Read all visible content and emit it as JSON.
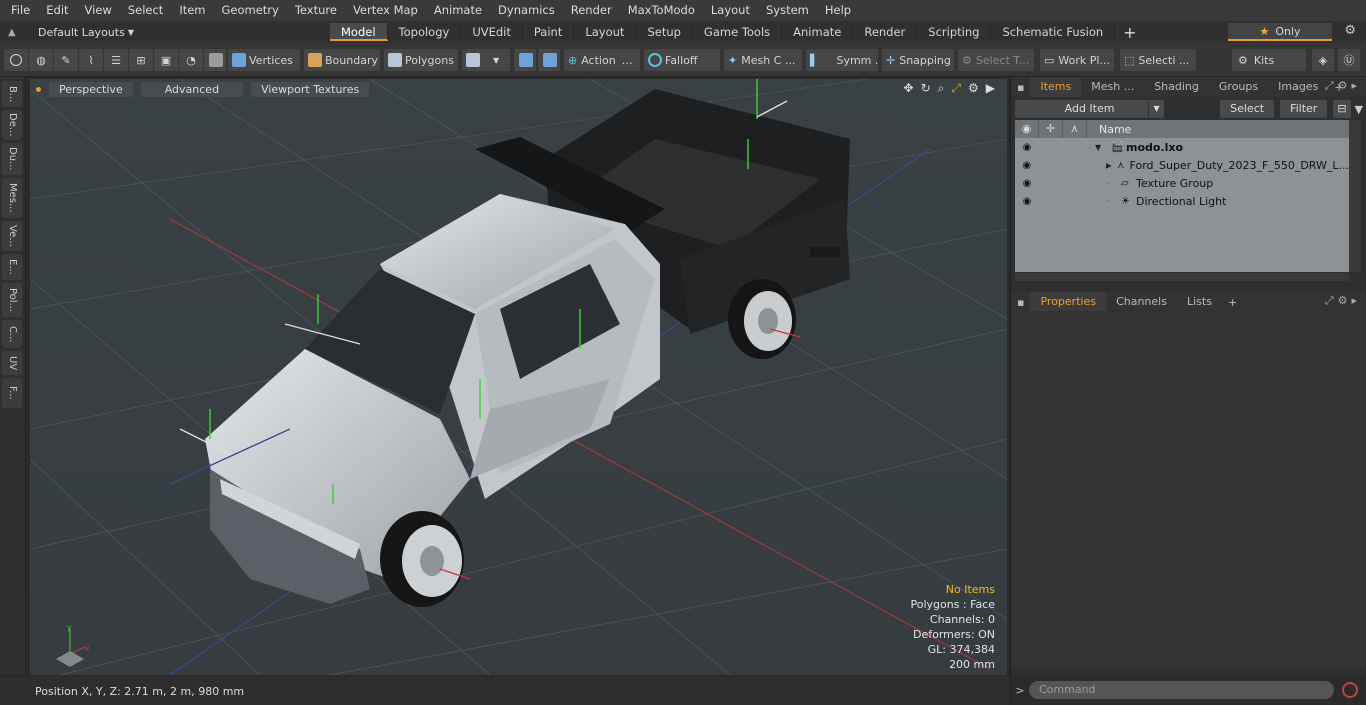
{
  "menubar": {
    "items": [
      "File",
      "Edit",
      "View",
      "Select",
      "Item",
      "Geometry",
      "Texture",
      "Vertex Map",
      "Animate",
      "Dynamics",
      "Render",
      "MaxToModo",
      "Layout",
      "System",
      "Help"
    ]
  },
  "tabbar": {
    "layout_label": "Default Layouts",
    "tabs": [
      "Model",
      "Topology",
      "UVEdit",
      "Paint",
      "Layout",
      "Setup",
      "Game Tools",
      "Animate",
      "Render",
      "Scripting",
      "Schematic Fusion"
    ],
    "active_tab": "Model",
    "only_label": "Only"
  },
  "toolbar": {
    "vertices": "Vertices",
    "boundary": "Boundary",
    "polygons": "Polygons",
    "action": "Action",
    "falloff": "Falloff",
    "mesh": "Mesh C ...",
    "symm": "Symm ...",
    "snapping": "Snapping",
    "select_t": "Select T...",
    "work_pl": "Work Pl...",
    "selecti": "Selecti ...",
    "kits": "Kits"
  },
  "leftstrip": {
    "tabs": [
      "B...",
      "De...",
      "Du...",
      "Mes...",
      "Ve...",
      "E...",
      "Pol...",
      "C...",
      "UV",
      "F..."
    ]
  },
  "viewport": {
    "perspective": "Perspective",
    "advanced": "Advanced",
    "viewport_textures": "Viewport Textures",
    "stats": {
      "no_items": "No Items",
      "polygons": "Polygons : Face",
      "channels": "Channels: 0",
      "deformers": "Deformers: ON",
      "gl": "GL: 374,384",
      "unit": "200 mm"
    }
  },
  "statusbar": {
    "position": "Position X, Y, Z:   2.71 m, 2 m, 980 mm"
  },
  "items_panel": {
    "tabs": [
      "Items",
      "Mesh ...",
      "Shading",
      "Groups",
      "Images"
    ],
    "active_tab": "Items",
    "add_item": "Add Item",
    "select": "Select",
    "filter": "Filter",
    "name_header": "Name",
    "rows": [
      {
        "name": "modo.lxo"
      },
      {
        "name": "Ford_Super_Duty_2023_F_550_DRW_L..."
      },
      {
        "name": "Texture Group"
      },
      {
        "name": "Directional Light"
      }
    ]
  },
  "properties_panel": {
    "tabs": [
      "Properties",
      "Channels",
      "Lists"
    ],
    "active_tab": "Properties"
  },
  "command": {
    "placeholder": "Command"
  }
}
